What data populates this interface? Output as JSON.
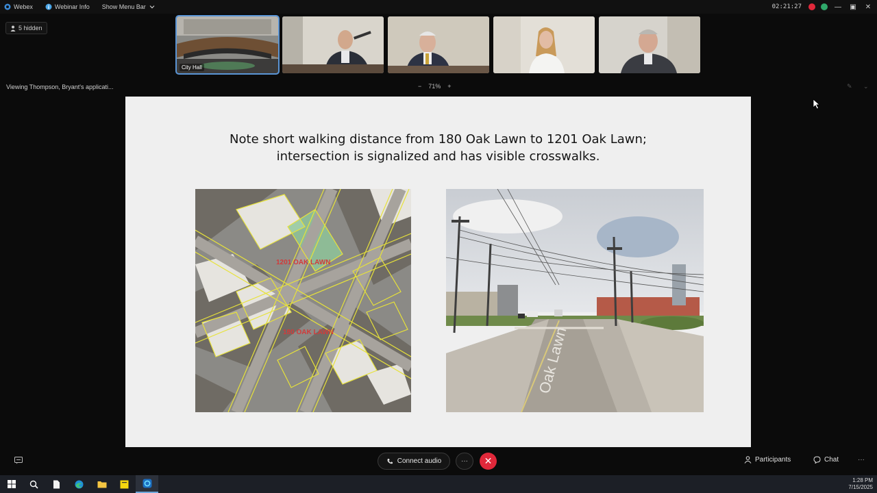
{
  "topbar": {
    "app_name": "Webex",
    "webinar_info": "Webinar Info",
    "show_menu_bar": "Show Menu Bar",
    "timer": "02:21:27"
  },
  "hidden_badge": "5 hidden",
  "participants_strip": [
    {
      "label": "City Hall"
    },
    {
      "label": ""
    },
    {
      "label": ""
    },
    {
      "label": ""
    },
    {
      "label": ""
    }
  ],
  "viewing": "Viewing Thompson, Bryant's applicati...",
  "zoom": {
    "minus": "−",
    "value": "71%",
    "plus": "+"
  },
  "slide": {
    "title_line1": "Note short walking distance from 180 Oak Lawn to 1201 Oak Lawn;",
    "title_line2": "intersection is signalized and has visible crosswalks.",
    "map_label_1": "1201 OAK LAWN",
    "map_label_2": "180 OAK LAWN",
    "street_sign": "Oak Lawn"
  },
  "controls": {
    "connect_audio": "Connect audio",
    "more": "···",
    "participants": "Participants",
    "chat": "Chat",
    "more_right": "···"
  },
  "clock": {
    "time": "1:28 PM",
    "date": "7/15/2025"
  },
  "colors": {
    "leave_red": "#e0283a",
    "active_tile_outline": "#5a95d6",
    "slide_bg": "#efefef"
  }
}
